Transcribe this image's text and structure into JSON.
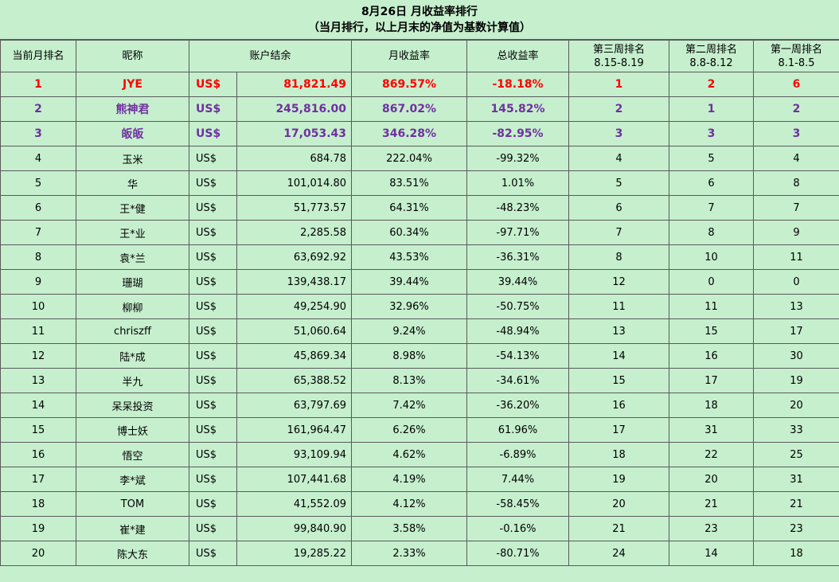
{
  "title": {
    "line1": "8月26日 月收益率排行",
    "line2": "（当月排行，以上月末的净值为基数计算值）"
  },
  "headers": {
    "rank": "当前月排名",
    "nickname": "昵称",
    "balance": "账户结余",
    "monthly_return": "月收益率",
    "total_return": "总收益率",
    "week3_line1": "第三周排名",
    "week3_line2": "8.15-8.19",
    "week2_line1": "第二周排名",
    "week2_line2": "8.8-8.12",
    "week1_line1": "第一周排名",
    "week1_line2": "8.1-8.5"
  },
  "colors": {
    "background": "#c6efce",
    "rank1": "#ff0000",
    "rank2_3": "#7030a0",
    "grid": "#5a5a5a"
  },
  "rows": [
    {
      "rank": "1",
      "name": "JYE",
      "currency": "US$",
      "balance": "81,821.49",
      "monthly": "869.57%",
      "total": "-18.18%",
      "w3": "1",
      "w2": "2",
      "w1": "6"
    },
    {
      "rank": "2",
      "name": "熊神君",
      "currency": "US$",
      "balance": "245,816.00",
      "monthly": "867.02%",
      "total": "145.82%",
      "w3": "2",
      "w2": "1",
      "w1": "2"
    },
    {
      "rank": "3",
      "name": "皈皈",
      "currency": "US$",
      "balance": "17,053.43",
      "monthly": "346.28%",
      "total": "-82.95%",
      "w3": "3",
      "w2": "3",
      "w1": "3"
    },
    {
      "rank": "4",
      "name": "玉米",
      "currency": "US$",
      "balance": "684.78",
      "monthly": "222.04%",
      "total": "-99.32%",
      "w3": "4",
      "w2": "5",
      "w1": "4"
    },
    {
      "rank": "5",
      "name": "华",
      "currency": "US$",
      "balance": "101,014.80",
      "monthly": "83.51%",
      "total": "1.01%",
      "w3": "5",
      "w2": "6",
      "w1": "8"
    },
    {
      "rank": "6",
      "name": "王*健",
      "currency": "US$",
      "balance": "51,773.57",
      "monthly": "64.31%",
      "total": "-48.23%",
      "w3": "6",
      "w2": "7",
      "w1": "7"
    },
    {
      "rank": "7",
      "name": "王*业",
      "currency": "US$",
      "balance": "2,285.58",
      "monthly": "60.34%",
      "total": "-97.71%",
      "w3": "7",
      "w2": "8",
      "w1": "9"
    },
    {
      "rank": "8",
      "name": "袁*兰",
      "currency": "US$",
      "balance": "63,692.92",
      "monthly": "43.53%",
      "total": "-36.31%",
      "w3": "8",
      "w2": "10",
      "w1": "11"
    },
    {
      "rank": "9",
      "name": "珊瑚",
      "currency": "US$",
      "balance": "139,438.17",
      "monthly": "39.44%",
      "total": "39.44%",
      "w3": "12",
      "w2": "0",
      "w1": "0"
    },
    {
      "rank": "10",
      "name": "柳柳",
      "currency": "US$",
      "balance": "49,254.90",
      "monthly": "32.96%",
      "total": "-50.75%",
      "w3": "11",
      "w2": "11",
      "w1": "13"
    },
    {
      "rank": "11",
      "name": "chriszff",
      "currency": "US$",
      "balance": "51,060.64",
      "monthly": "9.24%",
      "total": "-48.94%",
      "w3": "13",
      "w2": "15",
      "w1": "17"
    },
    {
      "rank": "12",
      "name": "陆*成",
      "currency": "US$",
      "balance": "45,869.34",
      "monthly": "8.98%",
      "total": "-54.13%",
      "w3": "14",
      "w2": "16",
      "w1": "30"
    },
    {
      "rank": "13",
      "name": "半九",
      "currency": "US$",
      "balance": "65,388.52",
      "monthly": "8.13%",
      "total": "-34.61%",
      "w3": "15",
      "w2": "17",
      "w1": "19"
    },
    {
      "rank": "14",
      "name": "呆呆投资",
      "currency": "US$",
      "balance": "63,797.69",
      "monthly": "7.42%",
      "total": "-36.20%",
      "w3": "16",
      "w2": "18",
      "w1": "20"
    },
    {
      "rank": "15",
      "name": "博士妖",
      "currency": "US$",
      "balance": "161,964.47",
      "monthly": "6.26%",
      "total": "61.96%",
      "w3": "17",
      "w2": "31",
      "w1": "33"
    },
    {
      "rank": "16",
      "name": "悟空",
      "currency": "US$",
      "balance": "93,109.94",
      "monthly": "4.62%",
      "total": "-6.89%",
      "w3": "18",
      "w2": "22",
      "w1": "25"
    },
    {
      "rank": "17",
      "name": "李*斌",
      "currency": "US$",
      "balance": "107,441.68",
      "monthly": "4.19%",
      "total": "7.44%",
      "w3": "19",
      "w2": "20",
      "w1": "31"
    },
    {
      "rank": "18",
      "name": "TOM",
      "currency": "US$",
      "balance": "41,552.09",
      "monthly": "4.12%",
      "total": "-58.45%",
      "w3": "20",
      "w2": "21",
      "w1": "21"
    },
    {
      "rank": "19",
      "name": "崔*建",
      "currency": "US$",
      "balance": "99,840.90",
      "monthly": "3.58%",
      "total": "-0.16%",
      "w3": "21",
      "w2": "23",
      "w1": "23"
    },
    {
      "rank": "20",
      "name": "陈大东",
      "currency": "US$",
      "balance": "19,285.22",
      "monthly": "2.33%",
      "total": "-80.71%",
      "w3": "24",
      "w2": "14",
      "w1": "18"
    }
  ]
}
